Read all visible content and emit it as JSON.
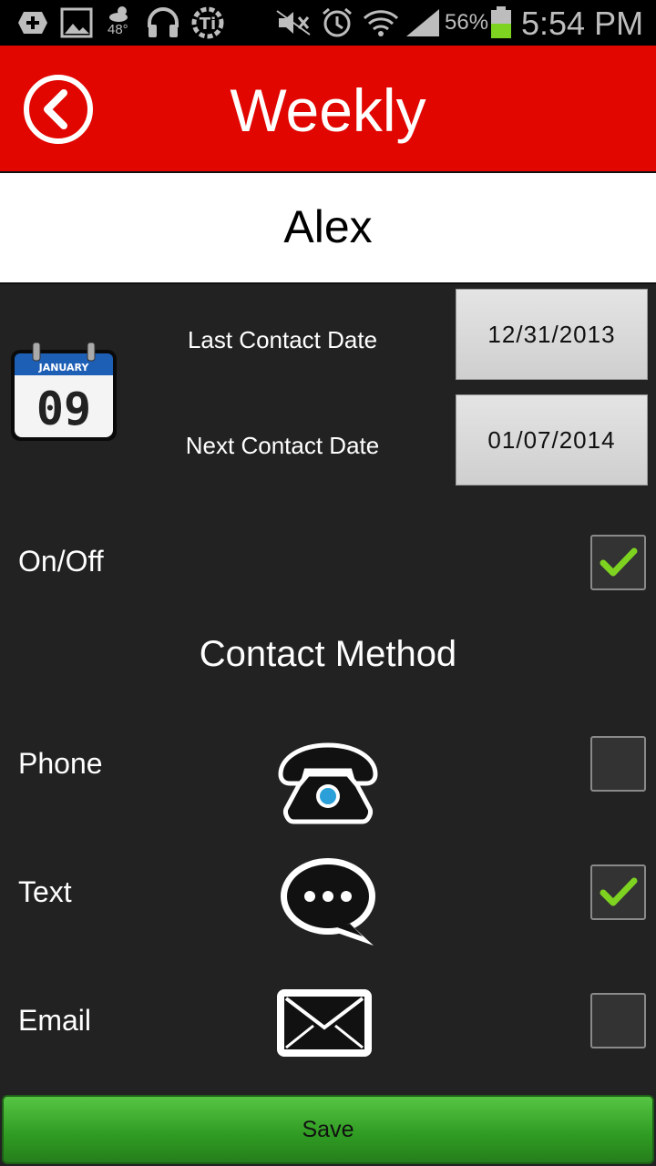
{
  "status_bar": {
    "weather_temp": "48°",
    "battery_percent": "56%",
    "time": "5:54 PM",
    "icons": [
      "add-icon",
      "image-icon",
      "weather-icon",
      "headphones-icon",
      "app-icon",
      "mute-icon",
      "alarm-icon",
      "wifi-icon",
      "signal-icon",
      "battery-icon"
    ]
  },
  "header": {
    "title": "Weekly"
  },
  "contact": {
    "name": "Alex"
  },
  "calendar_icon": {
    "month": "JANUARY",
    "day": "09"
  },
  "dates": {
    "last_label": "Last Contact Date",
    "last_value": "12/31/2013",
    "next_label": "Next Contact Date",
    "next_value": "01/07/2014"
  },
  "on_off": {
    "label": "On/Off",
    "checked": true
  },
  "contact_method": {
    "title": "Contact Method",
    "methods": [
      {
        "label": "Phone",
        "icon": "phone-icon",
        "checked": false
      },
      {
        "label": "Text",
        "icon": "message-icon",
        "checked": true
      },
      {
        "label": "Email",
        "icon": "envelope-icon",
        "checked": false
      }
    ]
  },
  "save_label": "Save",
  "colors": {
    "header_red": "#e10600",
    "background": "#222222",
    "check_green": "#7ed321",
    "save_green": "#3aa82b"
  }
}
